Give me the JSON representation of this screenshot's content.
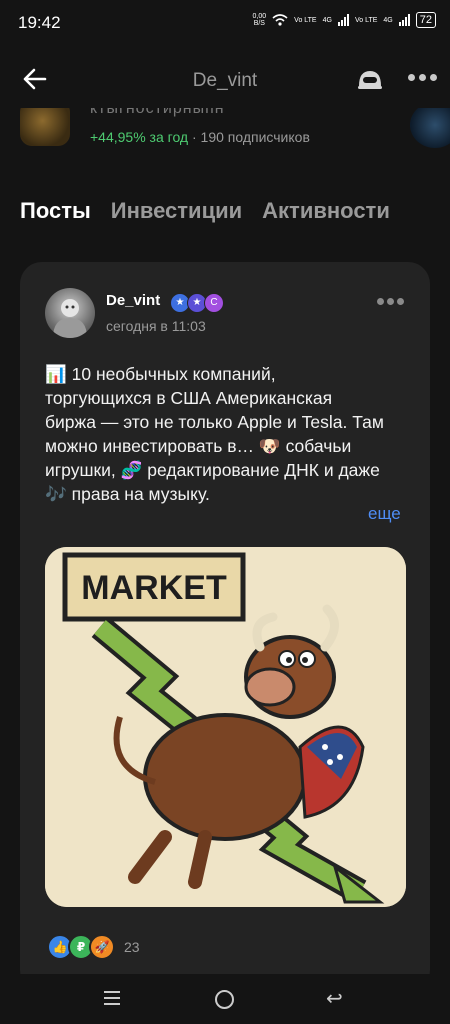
{
  "status": {
    "time": "19:42",
    "net_speed": "0,00",
    "net_unit": "B/S",
    "sim1": "Vo LTE",
    "sim1_net": "4G",
    "sim2": "Vo LTE",
    "sim2_net": "4G",
    "battery": "72"
  },
  "header": {
    "title": "De_vint"
  },
  "strategy": {
    "name_cut": "ктыгностирныпн",
    "gain": "+44,95% за год",
    "separator": " · ",
    "subscribers": "190 подписчиков"
  },
  "tabs": [
    {
      "label": "Посты",
      "active": true
    },
    {
      "label": "Инвестиции",
      "active": false
    },
    {
      "label": "Активности",
      "active": false
    }
  ],
  "post": {
    "author": "De_vint",
    "date": "сегодня в 11:03",
    "text": "📊 10 необычных компаний, торгующихся в США Американская биржа — это не только Apple и Tesla. Там можно инвестировать в… 🐶 собачьи игрушки, 🧬 редактирование ДНК и даже 🎶 права на музыку.",
    "more_label": "еще",
    "image_sign": "MARKET",
    "reactions_count": "23"
  },
  "colors": {
    "accent": "#4f8df5",
    "gain": "#4ecb71",
    "background": "#141414",
    "card": "#232323"
  }
}
